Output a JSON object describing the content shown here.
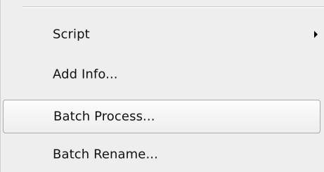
{
  "menu": {
    "items": [
      {
        "label": "Script",
        "has_submenu": true,
        "icon": "triangle-right-icon"
      },
      {
        "label": "Add Info..."
      },
      {
        "label": "Batch Process...",
        "highlighted": true
      },
      {
        "label": "Batch Rename..."
      }
    ]
  },
  "colors": {
    "menu_background": "#eeeeee",
    "highlight_border": "#a9a9a9",
    "text": "#111111"
  }
}
